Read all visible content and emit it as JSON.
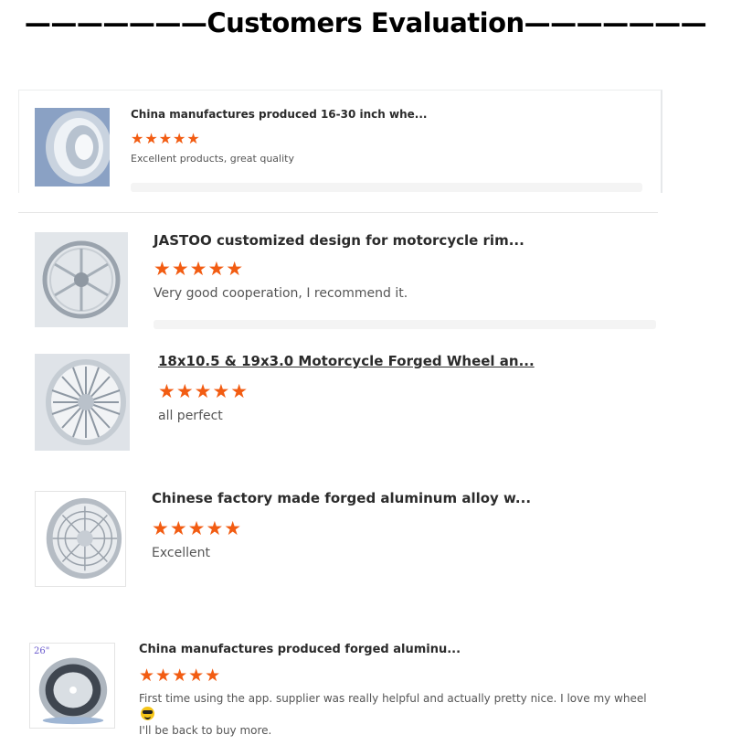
{
  "header": {
    "title": "———————Customers Evaluation———————"
  },
  "reviews": [
    {
      "product": "China manufactures produced 16-30 inch whe...",
      "stars": "★★★★★",
      "rating": 5,
      "comment": "Excellent products, great quality",
      "image_icon": "wheel-rim-icon"
    },
    {
      "product": "JASTOO customized design for motorcycle rim...",
      "stars": "★★★★★",
      "rating": 5,
      "comment": "Very good cooperation, I recommend it.",
      "image_icon": "motorcycle-rim-icon"
    },
    {
      "product": "18x10.5 & 19x3.0 Motorcycle Forged Wheel an...",
      "stars": "★★★★★",
      "rating": 5,
      "comment": "all perfect",
      "image_icon": "forged-wheel-icon"
    },
    {
      "product": "Chinese factory made forged aluminum alloy w...",
      "stars": "★★★★★",
      "rating": 5,
      "comment": "Excellent",
      "image_icon": "mesh-wheel-icon"
    },
    {
      "product": "China manufactures produced forged aluminu...",
      "stars": "★★★★★",
      "rating": 5,
      "comment": "First time using the app. supplier was really helpful and actually pretty nice. I love my wheel",
      "comment_line2": "I'll be back to buy more.",
      "image_icon": "wheel-barrel-icon",
      "image_badge": "26\""
    }
  ],
  "colors": {
    "star": "#f25c12",
    "text": "#2b2b2b",
    "muted": "#555555"
  }
}
